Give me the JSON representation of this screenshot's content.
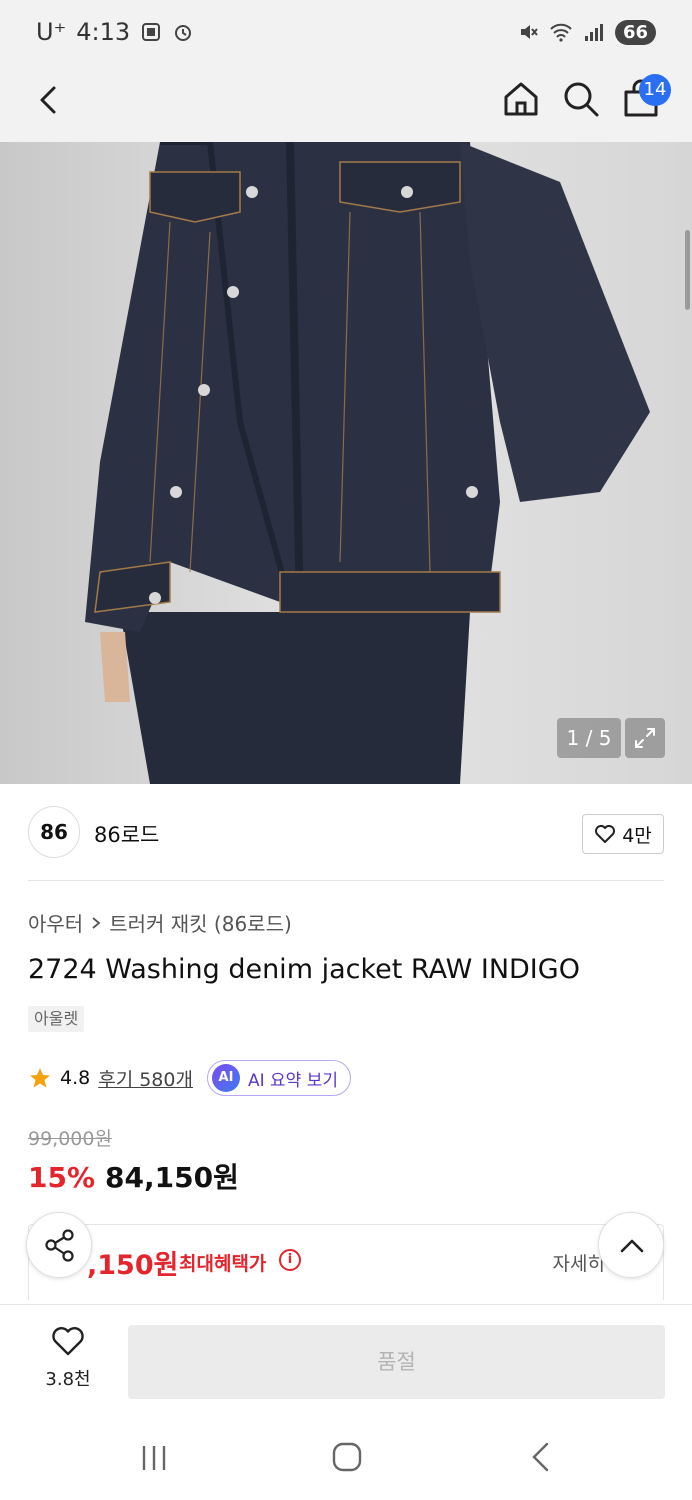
{
  "status_bar": {
    "carrier": "U⁺",
    "time": "4:13",
    "battery": "66"
  },
  "header": {
    "cart_count": "14"
  },
  "gallery": {
    "pager": "1 / 5"
  },
  "brand": {
    "logo_text": "86",
    "name": "86로드",
    "likes": "4만"
  },
  "product": {
    "breadcrumb": [
      "아우터",
      "트러커 재킷 (86로드)"
    ],
    "title": "2724 Washing denim jacket RAW INDIGO",
    "tag": "아울렛",
    "rating": "4.8",
    "reviews_link": "후기 580개",
    "ai_badge": "AI",
    "ai_summary_label": "AI 요약 보기",
    "original_price": "99,000원",
    "discount": "15%",
    "price": "84,150원"
  },
  "benefit": {
    "price": ",150원",
    "label": "최대혜택가",
    "info_icon": "i",
    "detail": "자세히"
  },
  "bottom": {
    "wish_count": "3.8천",
    "soldout_label": "품절"
  }
}
